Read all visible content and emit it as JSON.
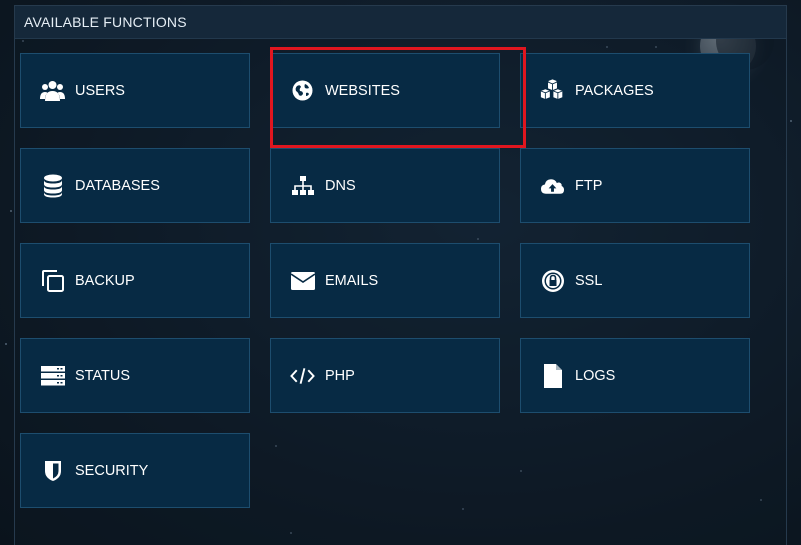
{
  "panel": {
    "title": "AVAILABLE FUNCTIONS"
  },
  "functions": [
    {
      "label": "USERS",
      "icon": "users-icon"
    },
    {
      "label": "WEBSITES",
      "icon": "globe-icon",
      "highlighted": true
    },
    {
      "label": "PACKAGES",
      "icon": "cubes-icon"
    },
    {
      "label": "DATABASES",
      "icon": "database-icon"
    },
    {
      "label": "DNS",
      "icon": "sitemap-icon"
    },
    {
      "label": "FTP",
      "icon": "cloud-upload-icon"
    },
    {
      "label": "BACKUP",
      "icon": "clone-icon"
    },
    {
      "label": "EMAILS",
      "icon": "envelope-icon"
    },
    {
      "label": "SSL",
      "icon": "lock-badge-icon"
    },
    {
      "label": "STATUS",
      "icon": "server-icon"
    },
    {
      "label": "PHP",
      "icon": "code-icon"
    },
    {
      "label": "LOGS",
      "icon": "file-icon"
    },
    {
      "label": "SECURITY",
      "icon": "shield-icon"
    }
  ],
  "colors": {
    "tile_background": "#072a44",
    "tile_border": "#1d4d6e",
    "highlight_border": "#e0161f",
    "text": "#ffffff"
  }
}
